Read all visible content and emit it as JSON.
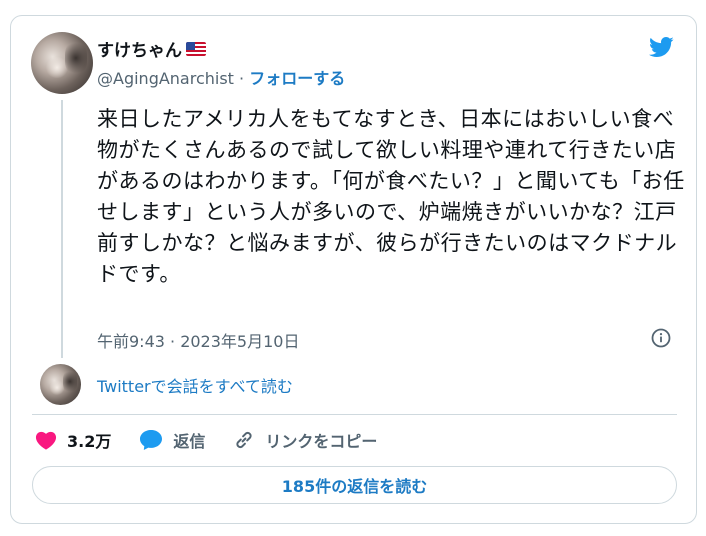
{
  "author": {
    "display_name": "すけちゃん",
    "handle": "@AgingAnarchist",
    "separator": " · ",
    "follow_label": "フォローする",
    "flag": "US flag"
  },
  "tweet": {
    "text": "来日したアメリカ人をもてなすとき、日本にはおいしい食べ物がたくさんあるので試して欲しい料理や連れて行きたい店があるのはわかります。「何が食べたい？」と聞いても「お任せします」という人が多いので、炉端焼きがいいかな？江戸前すしかな？と悩みますが、彼らが行きたいのはマクドナルドです。",
    "timestamp": "午前9:43 · 2023年5月10日"
  },
  "thread_link": "Twitterで会話をすべて読む",
  "actions": {
    "like_count": "3.2万",
    "reply_label": "返信",
    "copy_link_label": "リンクをコピー"
  },
  "read_replies_label": "185件の返信を読む",
  "colors": {
    "twitter_blue": "#1d9bf0",
    "link_blue": "#1d7bc4",
    "like_pink": "#f91880",
    "muted": "#536471"
  },
  "icons": [
    "twitter-bird-icon",
    "info-icon",
    "heart-icon",
    "speech-bubble-icon",
    "link-icon"
  ]
}
